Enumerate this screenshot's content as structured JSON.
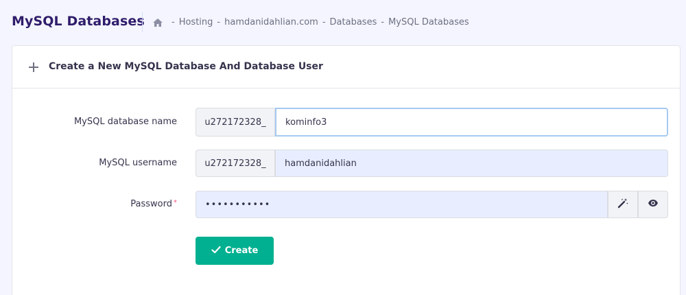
{
  "header": {
    "title": "MySQL Databases",
    "breadcrumb": [
      "Hosting",
      "hamdanidahlian.com",
      "Databases",
      "MySQL Databases"
    ],
    "separator": "-"
  },
  "card": {
    "title": "Create a New MySQL Database And Database User"
  },
  "form": {
    "db_name_label": "MySQL database name",
    "db_prefix": "u272172328_",
    "db_name_value": "kominfo3",
    "username_label": "MySQL username",
    "username_prefix": "u272172328_",
    "username_value": "hamdanidahlian",
    "password_label": "Password",
    "password_required_mark": "*",
    "password_value": "•••••••••••",
    "create_label": "Create"
  },
  "icons": {
    "home": "home-icon",
    "plus": "plus-icon",
    "generate": "magic-wand-icon",
    "toggle": "eye-icon",
    "create": "check-icon"
  },
  "colors": {
    "primary_text": "#2f1c6a",
    "success": "#00b090",
    "required": "#fc5185",
    "focus_border": "#a6c9f2",
    "filled_bg": "#e8eeff"
  }
}
